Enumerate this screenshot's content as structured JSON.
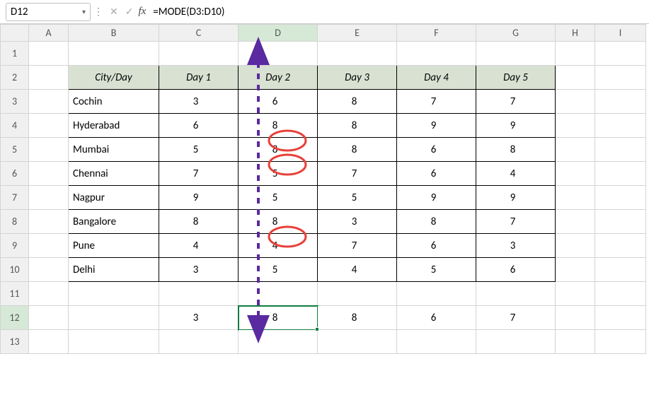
{
  "name_box": {
    "value": "D12"
  },
  "formula_bar": {
    "fx_label": "fx",
    "formula": "=MODE(D3:D10)"
  },
  "col_headers": [
    "A",
    "B",
    "C",
    "D",
    "E",
    "F",
    "G",
    "H",
    "I"
  ],
  "active_col": "D",
  "active_row": "12",
  "row_headers": [
    "1",
    "2",
    "3",
    "4",
    "5",
    "6",
    "7",
    "8",
    "9",
    "10",
    "11",
    "12",
    "13"
  ],
  "table": {
    "header": [
      "City/Day",
      "Day 1",
      "Day 2",
      "Day 3",
      "Day 4",
      "Day 5"
    ],
    "rows": [
      {
        "city": "Cochin",
        "d": [
          3,
          6,
          8,
          7,
          7
        ]
      },
      {
        "city": "Hyderabad",
        "d": [
          6,
          8,
          8,
          9,
          9
        ]
      },
      {
        "city": "Mumbai",
        "d": [
          5,
          8,
          8,
          6,
          8
        ]
      },
      {
        "city": "Chennai",
        "d": [
          7,
          5,
          7,
          6,
          4
        ]
      },
      {
        "city": "Nagpur",
        "d": [
          9,
          5,
          5,
          9,
          9
        ]
      },
      {
        "city": "Bangalore",
        "d": [
          8,
          8,
          3,
          8,
          7
        ]
      },
      {
        "city": "Pune",
        "d": [
          4,
          4,
          7,
          6,
          3
        ]
      },
      {
        "city": "Delhi",
        "d": [
          3,
          5,
          4,
          5,
          6
        ]
      }
    ]
  },
  "results": [
    3,
    8,
    8,
    6,
    7
  ],
  "chart_data": {
    "type": "table",
    "title": "Mode of daily values per city",
    "columns": [
      "City/Day",
      "Day 1",
      "Day 2",
      "Day 3",
      "Day 4",
      "Day 5"
    ],
    "rows": [
      [
        "Cochin",
        3,
        6,
        8,
        7,
        7
      ],
      [
        "Hyderabad",
        6,
        8,
        8,
        9,
        9
      ],
      [
        "Mumbai",
        5,
        8,
        8,
        6,
        8
      ],
      [
        "Chennai",
        7,
        5,
        7,
        6,
        4
      ],
      [
        "Nagpur",
        9,
        5,
        5,
        9,
        9
      ],
      [
        "Bangalore",
        8,
        8,
        3,
        8,
        7
      ],
      [
        "Pune",
        4,
        4,
        7,
        6,
        3
      ],
      [
        "Delhi",
        3,
        5,
        4,
        5,
        6
      ]
    ],
    "mode_row": [
      3,
      8,
      8,
      6,
      7
    ],
    "formula": "=MODE(D3:D10)"
  }
}
